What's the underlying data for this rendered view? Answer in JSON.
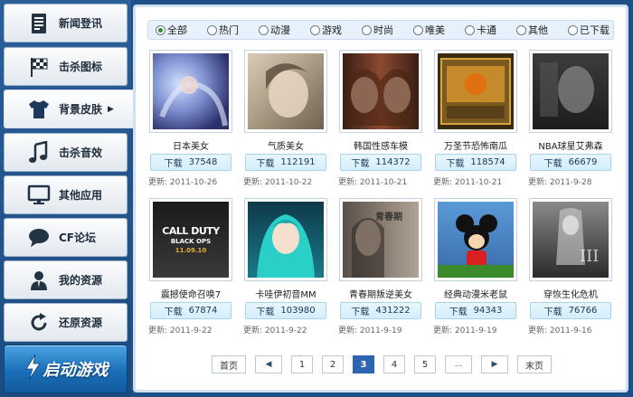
{
  "sidebar": {
    "items": [
      {
        "label": "新闻登讯",
        "icon": "document-icon"
      },
      {
        "label": "击杀图标",
        "icon": "checkered-flag-icon"
      },
      {
        "label": "背景皮肤",
        "icon": "tshirt-icon",
        "active": true
      },
      {
        "label": "击杀音效",
        "icon": "music-note-icon"
      },
      {
        "label": "其他应用",
        "icon": "monitor-icon"
      },
      {
        "label": "CF论坛",
        "icon": "speech-bubble-icon"
      },
      {
        "label": "我的资源",
        "icon": "user-icon"
      },
      {
        "label": "还原资源",
        "icon": "refresh-icon"
      }
    ],
    "active_arrow": "▶",
    "start_button": {
      "label": "启动游戏",
      "icon": "lightning-icon"
    }
  },
  "filters": [
    {
      "label": "全部",
      "checked": true
    },
    {
      "label": "热门",
      "checked": false
    },
    {
      "label": "动漫",
      "checked": false
    },
    {
      "label": "游戏",
      "checked": false
    },
    {
      "label": "时尚",
      "checked": false
    },
    {
      "label": "唯美",
      "checked": false
    },
    {
      "label": "卡通",
      "checked": false
    },
    {
      "label": "其他",
      "checked": false
    },
    {
      "label": "已下载",
      "checked": false
    }
  ],
  "download_label": "下载",
  "updated_label": "更新:",
  "items": [
    {
      "title": "日本美女",
      "downloads": "37548",
      "date": "2011-10-26"
    },
    {
      "title": "气质美女",
      "downloads": "112191",
      "date": "2011-10-22"
    },
    {
      "title": "韩国性感车模",
      "downloads": "114372",
      "date": "2011-10-21"
    },
    {
      "title": "万圣节恐怖南瓜",
      "downloads": "118574",
      "date": "2011-10-21"
    },
    {
      "title": "NBA球星艾弗森",
      "downloads": "66679",
      "date": "2011-9-28"
    },
    {
      "title": "震撼使命召唤7",
      "downloads": "67874",
      "date": "2011-9-22"
    },
    {
      "title": "卡哇伊初音MM",
      "downloads": "103980",
      "date": "2011-9-22"
    },
    {
      "title": "青春期叛逆美女",
      "downloads": "431222",
      "date": "2011-9-19"
    },
    {
      "title": "经典动漫米老鼠",
      "downloads": "94343",
      "date": "2011-9-19"
    },
    {
      "title": "穿恢生化危机",
      "downloads": "76766",
      "date": "2011-9-16"
    }
  ],
  "thumb_text": {
    "cod_line1": "CALL DUTY",
    "cod_line2": "BLACK OPS",
    "cod_line3": "11.09.10",
    "youth": "青春期"
  },
  "pagination": {
    "first": "首页",
    "prev": "◀",
    "pages": [
      "1",
      "2",
      "3",
      "4",
      "5"
    ],
    "current": "3",
    "ellipsis": "...",
    "next": "▶",
    "last": "末页"
  },
  "colors": {
    "background": "#1e4f86",
    "accent": "#2e65b3",
    "download_button": "#d3eefb"
  }
}
